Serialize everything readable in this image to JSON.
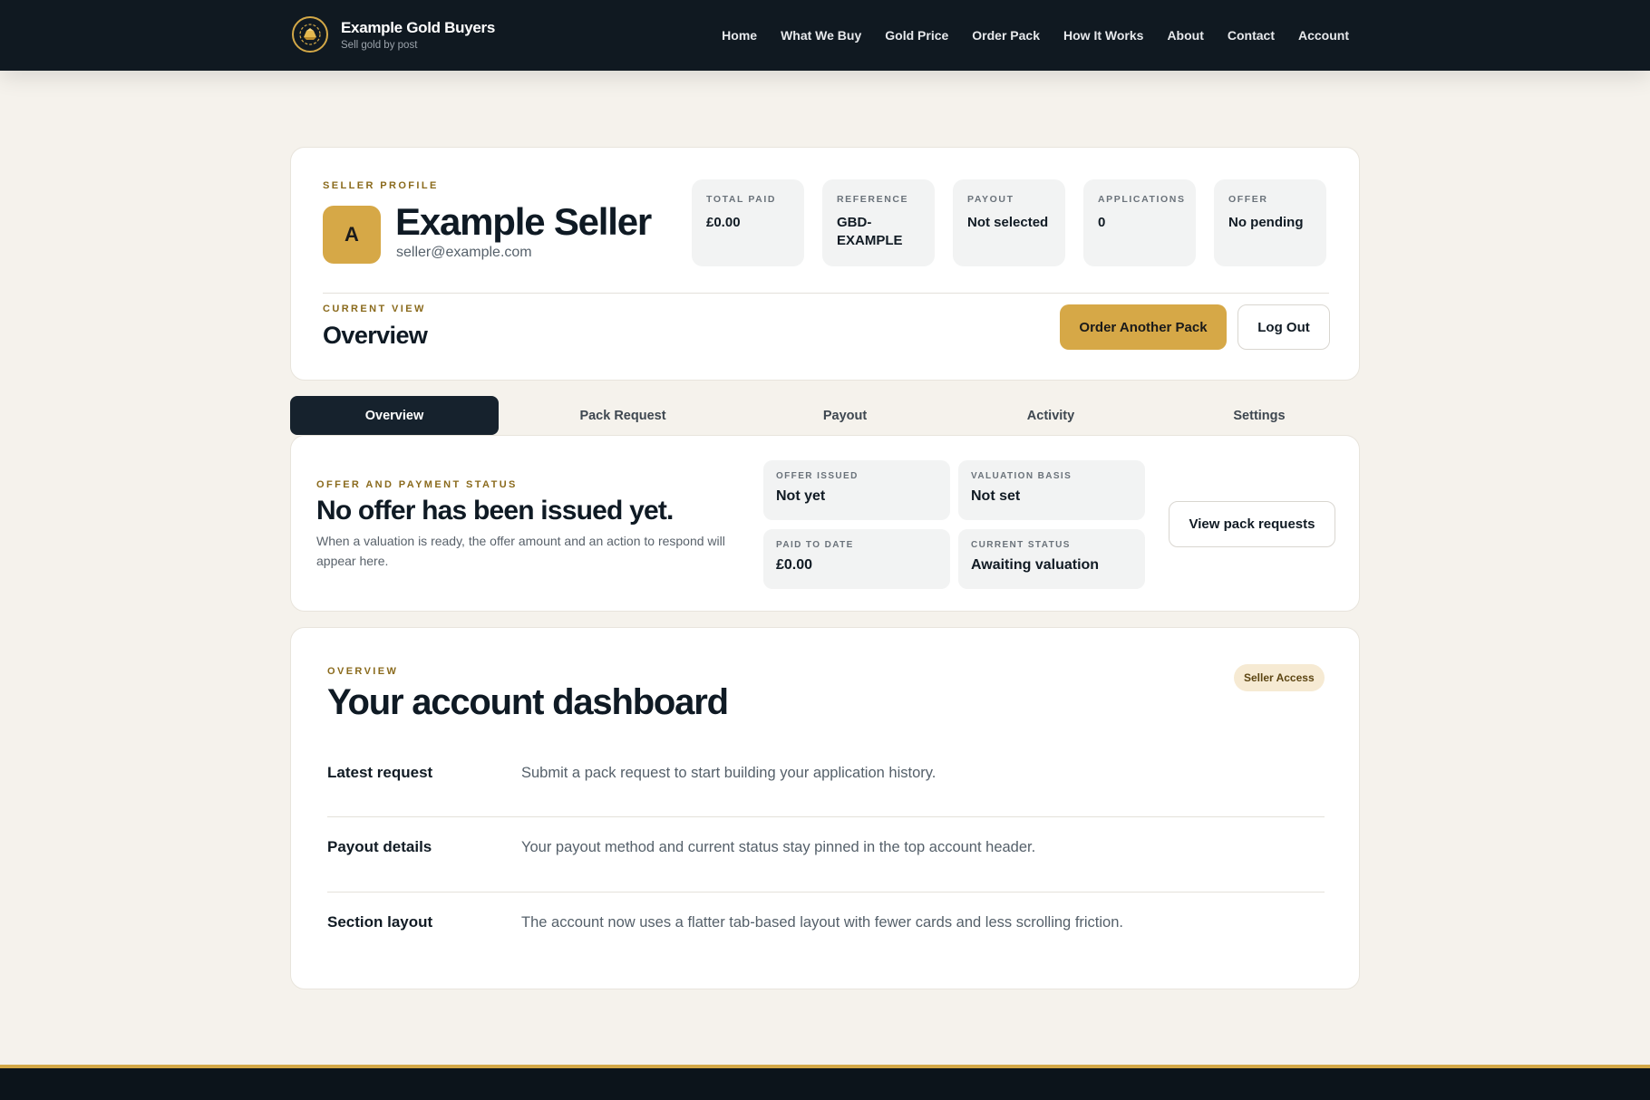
{
  "header": {
    "brand_name": "Example Gold Buyers",
    "brand_tagline": "Sell gold by post",
    "nav": [
      "Home",
      "What We Buy",
      "Gold Price",
      "Order Pack",
      "How It Works",
      "About",
      "Contact",
      "Account"
    ]
  },
  "profile": {
    "eyebrow": "SELLER PROFILE",
    "avatar_initial": "A",
    "name": "Example Seller",
    "email": "seller@example.com",
    "stats": [
      {
        "label": "TOTAL PAID",
        "value": "£0.00"
      },
      {
        "label": "REFERENCE",
        "value": "GBD-EXAMPLE"
      },
      {
        "label": "PAYOUT",
        "value": "Not selected"
      },
      {
        "label": "APPLICATIONS",
        "value": "0"
      },
      {
        "label": "OFFER",
        "value": "No pending"
      }
    ],
    "current_view_label": "CURRENT VIEW",
    "current_view": "Overview",
    "order_button": "Order Another Pack",
    "logout_button": "Log Out"
  },
  "tabs": [
    "Overview",
    "Pack Request",
    "Payout",
    "Activity",
    "Settings"
  ],
  "active_tab": "Overview",
  "offer": {
    "eyebrow": "OFFER AND PAYMENT STATUS",
    "title": "No offer has been issued yet.",
    "description": "When a valuation is ready, the offer amount and an action to respond will appear here.",
    "items": [
      {
        "label": "OFFER ISSUED",
        "value": "Not yet"
      },
      {
        "label": "VALUATION BASIS",
        "value": "Not set"
      },
      {
        "label": "PAID TO DATE",
        "value": "£0.00"
      },
      {
        "label": "CURRENT STATUS",
        "value": "Awaiting valuation"
      }
    ],
    "button": "View pack requests"
  },
  "dashboard": {
    "eyebrow": "OVERVIEW",
    "title": "Your account dashboard",
    "badge": "Seller Access",
    "rows": [
      {
        "label": "Latest request",
        "text": "Submit a pack request to start building your application history."
      },
      {
        "label": "Payout details",
        "text": "Your payout method and current status stay pinned in the top account header."
      },
      {
        "label": "Section layout",
        "text": "The account now uses a flatter tab-based layout with fewer cards and less scrolling friction."
      }
    ]
  },
  "colors": {
    "accent_gold": "#d6a847",
    "header_bg": "#101921",
    "page_bg": "#f5f2ec"
  }
}
